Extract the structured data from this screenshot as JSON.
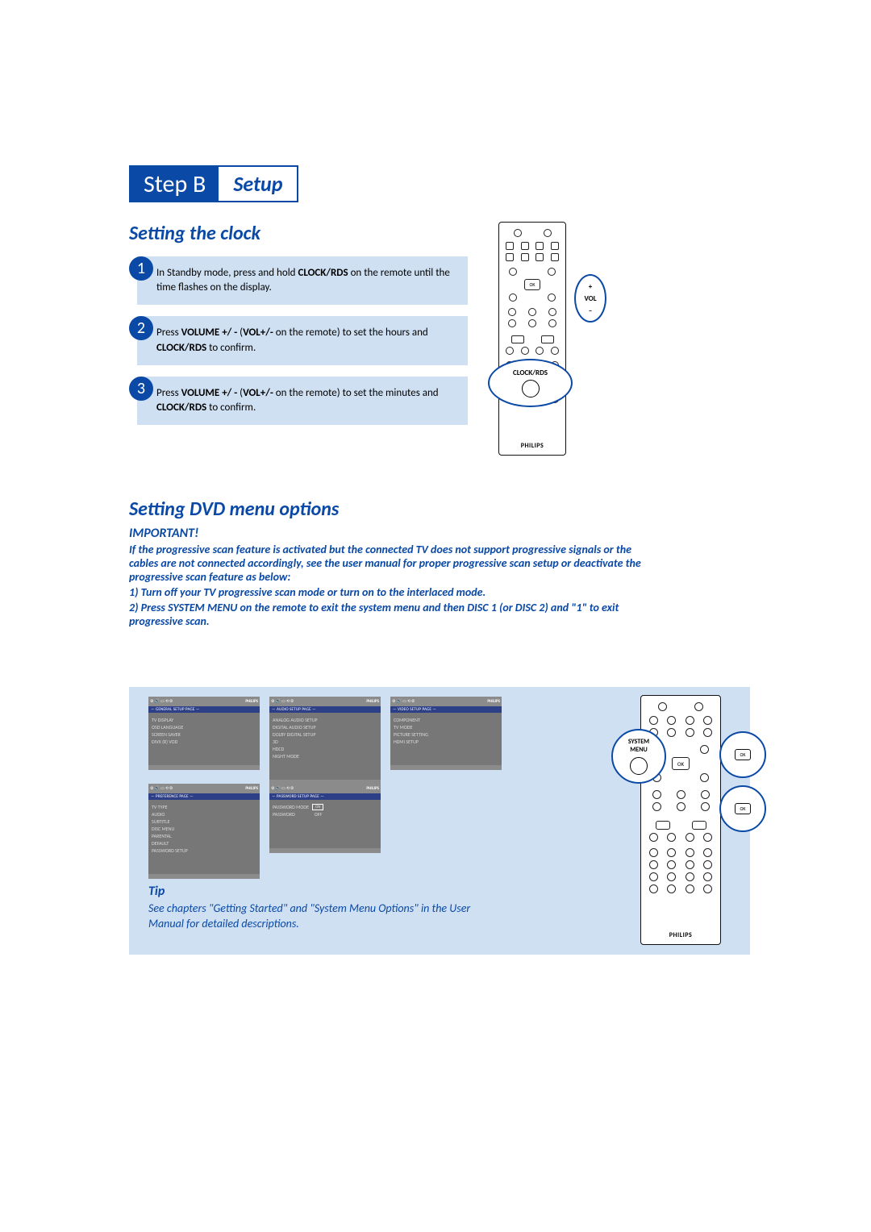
{
  "header": {
    "step": "Step B",
    "title": "Setup"
  },
  "clock": {
    "heading": "Setting the clock",
    "steps": [
      {
        "num": "1",
        "pre": "In Standby mode, press and hold ",
        "b1": "CLOCK/RDS",
        "post": " on the remote until the time flashes on the display."
      },
      {
        "num": "2",
        "pre": "Press ",
        "b1": "VOLUME +/ -",
        "mid1": "  (",
        "b2": "VOL+/-",
        "mid2": " on the remote) to set the hours and ",
        "b3": "CLOCK/RDS",
        "post": " to confirm."
      },
      {
        "num": "3",
        "pre": "Press ",
        "b1": "VOLUME +/ -",
        "mid1": "  (",
        "b2": "VOL+/-",
        "mid2": " on the remote) to set the minutes and ",
        "b3": "CLOCK/RDS",
        "post": " to confirm."
      }
    ]
  },
  "dvd": {
    "heading": "Setting DVD menu options",
    "important_label": "IMPORTANT!",
    "important": [
      "If the progressive scan feature is activated but the connected TV does not support progressive signals or the cables are not connected accordingly, see the user manual for proper progressive scan setup or deactivate the progressive scan feature as below:",
      "1) Turn off your TV progressive scan mode or turn on to the interlaced mode.",
      "2) Press SYSTEM MENU on the remote to exit the system menu and then DISC 1 (or DISC 2) and \"1\" to exit progressive scan."
    ]
  },
  "menus": {
    "brand": "PHILIPS",
    "general": {
      "title": "— GENERAL SETUP PAGE —",
      "items": [
        "TV DISPLAY",
        "OSD LANGUAGE",
        "SCREEN SAVER",
        "DIVX (R) VOD"
      ]
    },
    "audio": {
      "title": "— AUDIO SETUP PAGE —",
      "items": [
        "ANALOG AUDIO SETUP",
        "DIGITAL AUDIO SETUP",
        "DOLBY DIGITAL SETUP",
        "3D",
        "HDCD",
        "NIGHT MODE"
      ]
    },
    "video": {
      "title": "— VIDEO SETUP PAGE —",
      "items": [
        "COMPONENT",
        "TV MODE",
        "PICTURE SETTING",
        "HDMI SETUP"
      ]
    },
    "pref": {
      "title": "— PREFERENCE PAGE —",
      "items": [
        "TV TYPE",
        "AUDIO",
        "SUBTITLE",
        "DISC MENU",
        "PARENTAL",
        "DEFAULT",
        "PASSWORD SETUP"
      ]
    },
    "password": {
      "title": "— PASSWORD SETUP PAGE —",
      "row1_label": "PASSWORD MODE",
      "row1_value": "ON",
      "row2_label": "PASSWORD",
      "row2_value": "OFF"
    }
  },
  "tip": {
    "heading": "Tip",
    "body": "See chapters \"Getting Started\" and \"System Menu Options\" in the User Manual for detailed descriptions."
  },
  "callouts": {
    "vol_plus": "+",
    "vol_label": "VOL",
    "vol_minus": "–",
    "clock_label": "CLOCK/RDS",
    "system_label1": "SYSTEM",
    "system_label2": "MENU",
    "ok": "OK"
  },
  "brand": "PHILIPS"
}
